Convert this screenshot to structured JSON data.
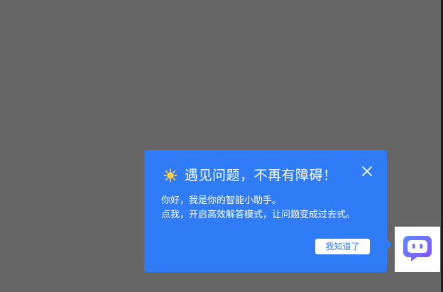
{
  "popup": {
    "title": "遇见问题，不再有障碍！",
    "line1": "你好，我是你的智能小助手。",
    "line2": "点我，开启高效解答模式，让问题变成过去式。",
    "ack_label": "我知道了",
    "icons": {
      "title": "sun-icon",
      "close": "close-icon",
      "assistant": "chat-bubble-icon"
    }
  },
  "colors": {
    "backdrop": "#666666",
    "popup": "#2f7cf6",
    "assistant_gradient_start": "#5b8cff",
    "assistant_gradient_end": "#8a4dff"
  }
}
